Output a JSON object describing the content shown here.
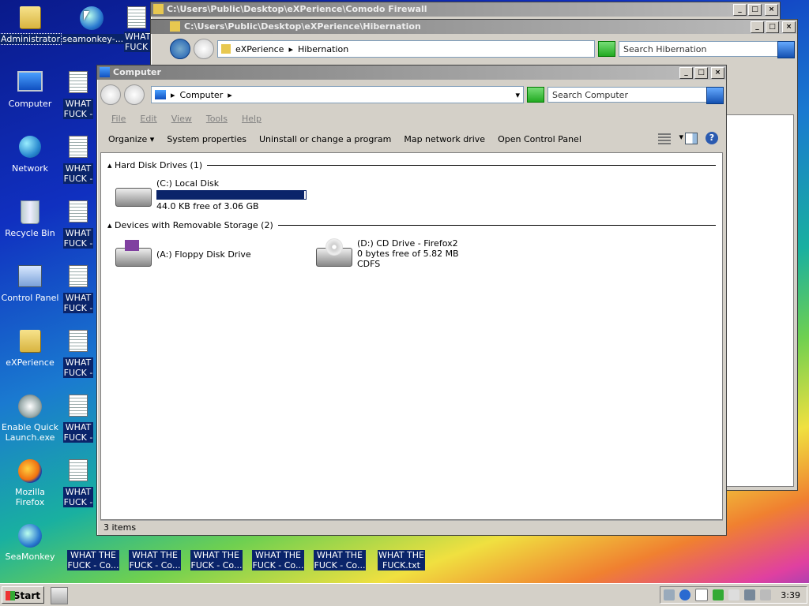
{
  "desktop": {
    "icons": [
      {
        "label": "Administrator"
      },
      {
        "label": "seamonkey-..."
      },
      {
        "label": "Computer"
      },
      {
        "label": "Network"
      },
      {
        "label": "Recycle Bin"
      },
      {
        "label": "Control Panel"
      },
      {
        "label": "eXPerience"
      },
      {
        "label": "Enable Quick Launch.exe"
      },
      {
        "label": "Mozilla Firefox"
      },
      {
        "label": "SeaMonkey"
      }
    ],
    "file_short": "WHAT",
    "file_short2": "FUCK -",
    "file_short_top2": "FUCK",
    "bottom_files": [
      {
        "l1": "WHAT THE",
        "l2": "FUCK - Co..."
      },
      {
        "l1": "WHAT THE",
        "l2": "FUCK - Co..."
      },
      {
        "l1": "WHAT THE",
        "l2": "FUCK - Co..."
      },
      {
        "l1": "WHAT THE",
        "l2": "FUCK - Co..."
      },
      {
        "l1": "WHAT THE",
        "l2": "FUCK - Co..."
      },
      {
        "l1": "WHAT THE",
        "l2": "FUCK.txt"
      }
    ]
  },
  "win_comodo": {
    "title": "C:\\Users\\Public\\Desktop\\eXPerience\\Comodo Firewall"
  },
  "win_hib": {
    "title": "C:\\Users\\Public\\Desktop\\eXPerience\\Hibernation",
    "crumb1": "eXPerience",
    "crumb2": "Hibernation",
    "search_placeholder": "Search Hibernation"
  },
  "win_computer": {
    "title": "Computer",
    "address": "Computer",
    "search_placeholder": "Search Computer",
    "menu": [
      "File",
      "Edit",
      "View",
      "Tools",
      "Help"
    ],
    "toolbar": [
      "Organize",
      "System properties",
      "Uninstall or change a program",
      "Map network drive",
      "Open Control Panel"
    ],
    "groups": {
      "hdd": "Hard Disk Drives (1)",
      "removable": "Devices with Removable Storage (2)"
    },
    "drives": {
      "c_name": "(C:) Local Disk",
      "c_free": "44.0 KB free of 3.06 GB",
      "c_usage": 0.99,
      "a_name": "(A:) Floppy Disk Drive",
      "d_name": "(D:) CD Drive - Firefox2",
      "d_free": "0 bytes free of 5.82 MB",
      "d_fs": "CDFS"
    },
    "status": "3 items"
  },
  "taskbar": {
    "start": "Start",
    "clock": "3:39"
  },
  "colors": {
    "selection": "#0a246a",
    "titlebar_inactive": "#9a9a9a"
  }
}
